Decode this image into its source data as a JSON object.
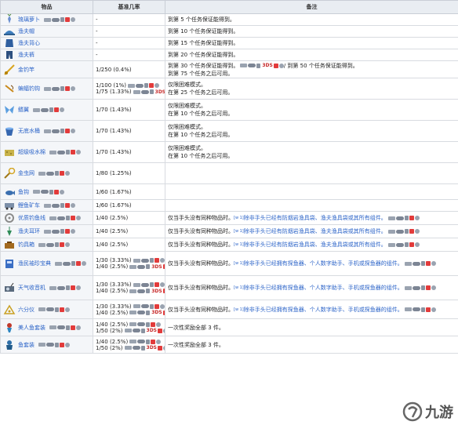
{
  "headers": {
    "item": "物品",
    "rate": "基准几率",
    "note": "备注"
  },
  "colors": {
    "header_bg": "#e9edf2",
    "link": "#2c64c8"
  },
  "rows": [
    {
      "icon": "radish-icon",
      "name": "琉璃萝卜",
      "rate": "-",
      "note": "到第 5 个任务保证能得到。",
      "plat": true
    },
    {
      "icon": "hat-icon",
      "name": "渔夫帽",
      "rate": "-",
      "note": "到第 10 个任务保证能得到。"
    },
    {
      "icon": "vest-icon",
      "name": "渔夫背心",
      "rate": "-",
      "note": "到第 15 个任务保证能得到。"
    },
    {
      "icon": "pants-icon",
      "name": "渔夫裤",
      "rate": "-",
      "note": "到第 20 个任务保证能得到。"
    },
    {
      "icon": "rod-icon",
      "name": "金钓竿",
      "rate": "1/250 (0.4%)",
      "note": "到第 30 个任务保证能得到。",
      "note2": "到第 75 个任务之后可用。",
      "note_mid": "/ 到第 50 个任务保证能得到。"
    },
    {
      "icon": "hook-icon",
      "name": "蝙蝠钓钩",
      "rate": "1/100 (1%)",
      "rate2": "1/75 (1.33%)",
      "note": "仅限困难模式。",
      "note2": "在第 25 个任务之后可用。"
    },
    {
      "icon": "wings-icon",
      "name": "鳍翼",
      "rate": "1/70 (1.43%)",
      "note": "仅限困难模式。",
      "note2": "在第 10 个任务之后可用。"
    },
    {
      "icon": "bucket-icon",
      "name": "无底水桶",
      "rate": "1/70 (1.43%)",
      "note": "仅限困难模式。",
      "note2": "在第 10 个任务之后可用。"
    },
    {
      "icon": "sponge-icon",
      "name": "超级吸水棉",
      "rate": "1/70 (1.43%)",
      "note": "仅限困难模式。",
      "note2": "在第 10 个任务之后可用。"
    },
    {
      "icon": "net-icon",
      "name": "金虫网",
      "rate": "1/80 (1.25%)",
      "note": ""
    },
    {
      "icon": "fish-icon",
      "name": "鱼钩",
      "rate": "1/60 (1.67%)",
      "note": ""
    },
    {
      "icon": "minecart-icon",
      "name": "鲤鱼矿车",
      "rate": "1/60 (1.67%)",
      "note": ""
    },
    {
      "icon": "line-icon",
      "name": "优质钓鱼线",
      "rate": "1/40 (2.5%)",
      "note": "仅当手头没有同种物品时。",
      "note_link": "除非手头已经有防烟岩渔具袋、渔夫渔具袋或其所有组件。"
    },
    {
      "icon": "earring-icon",
      "name": "渔夫耳环",
      "rate": "1/40 (2.5%)",
      "note": "仅当手头没有同种物品时。",
      "note_link": "除非手头已经有防烟岩渔具袋、渔夫渔具袋或其所有组件。"
    },
    {
      "icon": "tackle-icon",
      "name": "钓具箱",
      "rate": "1/40 (2.5%)",
      "note": "仅当手头没有同种物品时。",
      "note_link": "除非手头已经有防烟岩渔具袋、渔夫渔具袋或其所有组件。"
    },
    {
      "icon": "book-icon",
      "name": "渔民袖珍宝典",
      "rate": "1/30 (3.33%)",
      "rate2": "1/40 (2.5%)",
      "note": "仅当手头没有同种物品时。",
      "note_link": "除非手头已经拥有探鱼器、个人数字助手、手机或探鱼器的组件。"
    },
    {
      "icon": "radio-icon",
      "name": "天气收音机",
      "rate": "1/30 (3.33%)",
      "rate2": "1/40 (2.5%)",
      "note": "仅当手头没有同种物品时。",
      "note_link": "除非手头已经拥有探鱼器、个人数字助手、手机或探鱼器的组件。"
    },
    {
      "icon": "sextant-icon",
      "name": "六分仪",
      "rate": "1/30 (3.33%)",
      "rate2": "1/40 (2.5%)",
      "note": "仅当手头没有同种物品时。",
      "note_link": "除非手头已经拥有探鱼器、个人数字助手、手机或探鱼器的组件。"
    },
    {
      "icon": "mermaid-icon",
      "name": "美人鱼套装",
      "rate": "1/40 (2.5%)",
      "rate2": "1/50 (2%)",
      "note": "一次性奖励全部 3 件。"
    },
    {
      "icon": "fishcostume-icon",
      "name": "鱼套装",
      "rate": "1/40 (2.5%)",
      "rate2": "1/50 (2%)",
      "note": "一次性奖励全部 3 件。"
    }
  ],
  "sup_label": "[w 1]",
  "tds_label": "3DS",
  "watermark": "九游"
}
